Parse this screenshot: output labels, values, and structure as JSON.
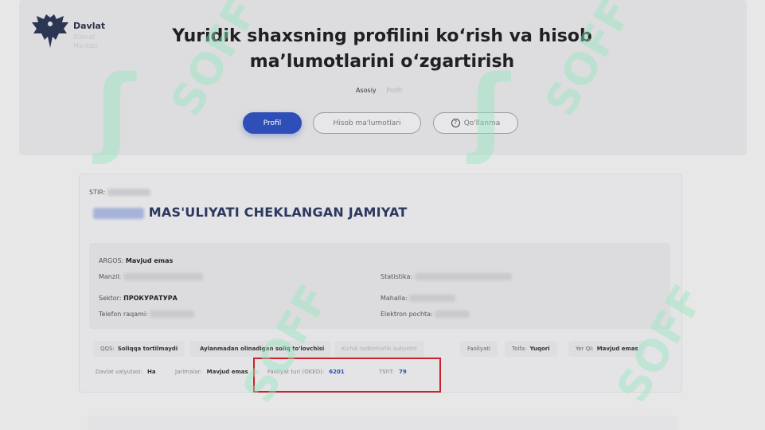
{
  "logo": {
    "name": "Davlat",
    "sub1": "Xizmat",
    "sub2": "Markazi"
  },
  "page_title": "Yuridik shaxsning profilini koʻrish va hisob maʼlumotlarini oʻzgartirish",
  "breadcrumb": [
    "Asosiy",
    "Profil"
  ],
  "tabs": [
    {
      "label": "Profil",
      "active": true
    },
    {
      "label": "Hisob ma'lumotlari",
      "active": false
    },
    {
      "label": "Qo'llanma",
      "active": false
    }
  ],
  "company": {
    "stir_label": "STIR:",
    "name_suffix": "MAS'ULIYATI CHEKLANGAN JAMIYAT"
  },
  "details": {
    "argos_label": "ARGOS:",
    "argos_value": "Mavjud emas",
    "address_label": "Manzil:",
    "statistics_label": "Statistika:",
    "sector_label": "Sektor:",
    "sector_value": "ПРОКУРАТУРА",
    "mahalla_label": "Mahalla:",
    "phone_label": "Telefon raqami:",
    "email_label": "Elektron pochta:"
  },
  "chips": [
    {
      "label": "QQS:",
      "value": "Soliqqa tortilmaydi"
    },
    {
      "label": "",
      "value": "Aylanmadan olinadigan soliq to'lovchisi"
    },
    {
      "label": "",
      "value": "Kichik tadbirkorlik subyekti"
    },
    {
      "label": "Faoliyati",
      "value": ""
    },
    {
      "label": "Toifa:",
      "value": "Yuqori"
    },
    {
      "label": "Yer QI:",
      "value": "Mavjud emas"
    }
  ],
  "row2": {
    "currency_label": "Davlat valyutasi:",
    "currency_value": "Ha",
    "fines_label": "Jarimalar:",
    "fines_value": "Mavjud emas",
    "activity_label": "Faoliyat turi (OKED):",
    "activity_value": "6201",
    "opf_label": "TShT:",
    "opf_value": "79"
  },
  "watermark": "SOFF"
}
